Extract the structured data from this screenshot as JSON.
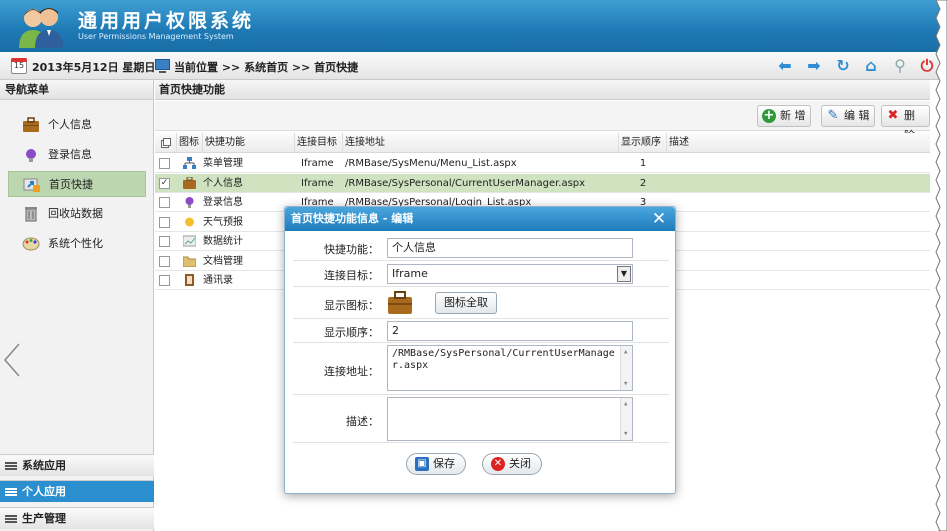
{
  "header": {
    "title": "通用用户权限系统",
    "subtitle": "User Permissions Management System"
  },
  "infobar": {
    "date": "2013年5月12日 星期日",
    "location": "当前位置 >> 系统首页 >> 首页快捷",
    "calendar_day": "15"
  },
  "nav": {
    "header": "导航菜单",
    "items": [
      {
        "label": "个人信息",
        "icon": "briefcase-icon"
      },
      {
        "label": "登录信息",
        "icon": "lightbulb-icon"
      },
      {
        "label": "首页快捷",
        "icon": "shortcut-icon"
      },
      {
        "label": "回收站数据",
        "icon": "recycle-bin-icon"
      },
      {
        "label": "系统个性化",
        "icon": "palette-icon"
      }
    ],
    "accordion": [
      "系统应用",
      "个人应用",
      "生产管理"
    ]
  },
  "panel": {
    "title": "首页快捷功能",
    "toolbar": {
      "add": "新 增",
      "edit": "编 辑",
      "delete": "删 除"
    }
  },
  "grid": {
    "columns": [
      "图标",
      "快捷功能",
      "连接目标",
      "连接地址",
      "显示顺序",
      "描述"
    ],
    "rows": [
      {
        "checked": false,
        "name": "菜单管理",
        "target": "Iframe",
        "url": "/RMBase/SysMenu/Menu_List.aspx",
        "order": "1",
        "desc": "",
        "icon": "sitemap-icon"
      },
      {
        "checked": true,
        "name": "个人信息",
        "target": "Iframe",
        "url": "/RMBase/SysPersonal/CurrentUserManager.aspx",
        "order": "2",
        "desc": "",
        "icon": "briefcase-icon"
      },
      {
        "checked": false,
        "name": "登录信息",
        "target": "Iframe",
        "url": "/RMBase/SysPersonal/Login_List.aspx",
        "order": "3",
        "desc": "",
        "icon": "lightbulb-icon"
      },
      {
        "checked": false,
        "name": "天气预报",
        "target": "",
        "url": "",
        "order": "",
        "desc": "",
        "icon": "sun-icon"
      },
      {
        "checked": false,
        "name": "数据统计",
        "target": "",
        "url": "",
        "order": "",
        "desc": "",
        "icon": "chart-icon"
      },
      {
        "checked": false,
        "name": "文档管理",
        "target": "",
        "url": "",
        "order": "",
        "desc": "",
        "icon": "folder-icon"
      },
      {
        "checked": false,
        "name": "通讯录",
        "target": "",
        "url": "",
        "order": "",
        "desc": "",
        "icon": "address-book-icon"
      }
    ]
  },
  "modal": {
    "title": "首页快捷功能信息 - 编辑",
    "fields": {
      "name_label": "快捷功能：",
      "name_value": "个人信息",
      "target_label": "连接目标：",
      "target_value": "Iframe",
      "icon_label": "显示图标：",
      "icon_button": "图标全取",
      "order_label": "显示顺序：",
      "order_value": "2",
      "url_label": "连接地址：",
      "url_value": "/RMBase/SysPersonal/CurrentUserManager.aspx",
      "desc_label": "描述：",
      "desc_value": ""
    },
    "buttons": {
      "save": "保存",
      "close": "关闭"
    }
  },
  "colors": {
    "header_blue": "#1d78b3",
    "selected_row": "#cfe3c0",
    "active_accordion": "#2b8fcf"
  }
}
